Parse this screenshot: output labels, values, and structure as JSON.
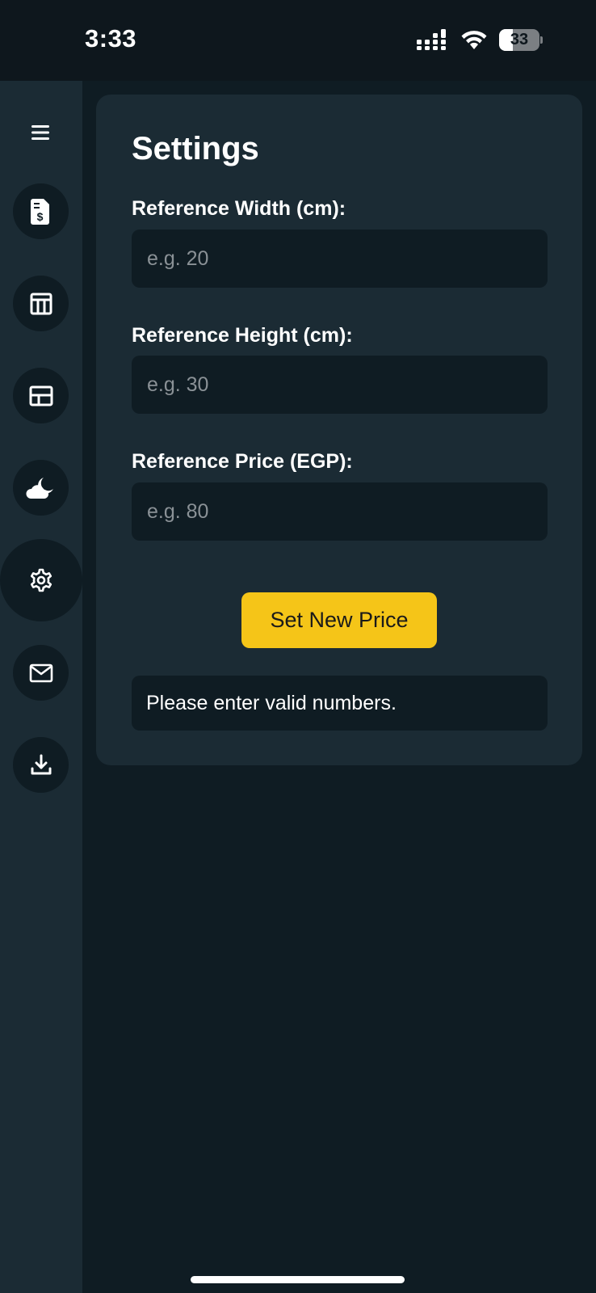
{
  "status_bar": {
    "time": "3:33",
    "battery_level": "33",
    "battery_fraction": 0.33
  },
  "sidebar": {
    "menu_icon": "hamburger-icon",
    "items": [
      {
        "icon": "invoice-dollar-icon",
        "active": false
      },
      {
        "icon": "table-layout-icon",
        "active": false
      },
      {
        "icon": "panel-layout-icon",
        "active": false
      },
      {
        "icon": "cloud-moon-icon",
        "active": false
      },
      {
        "icon": "gear-icon",
        "active": true
      },
      {
        "icon": "envelope-icon",
        "active": false
      },
      {
        "icon": "download-icon",
        "active": false
      }
    ]
  },
  "settings": {
    "title": "Settings",
    "width_label": "Reference Width (cm):",
    "width_placeholder": "e.g. 20",
    "width_value": "",
    "height_label": "Reference Height (cm):",
    "height_placeholder": "e.g. 30",
    "height_value": "",
    "price_label": "Reference Price (EGP):",
    "price_placeholder": "e.g. 80",
    "price_value": "",
    "submit_label": "Set New Price",
    "message": "Please enter valid numbers."
  },
  "colors": {
    "background": "#0f1c23",
    "panel": "#1b2b34",
    "accent": "#f5c518",
    "text": "#ffffff"
  }
}
